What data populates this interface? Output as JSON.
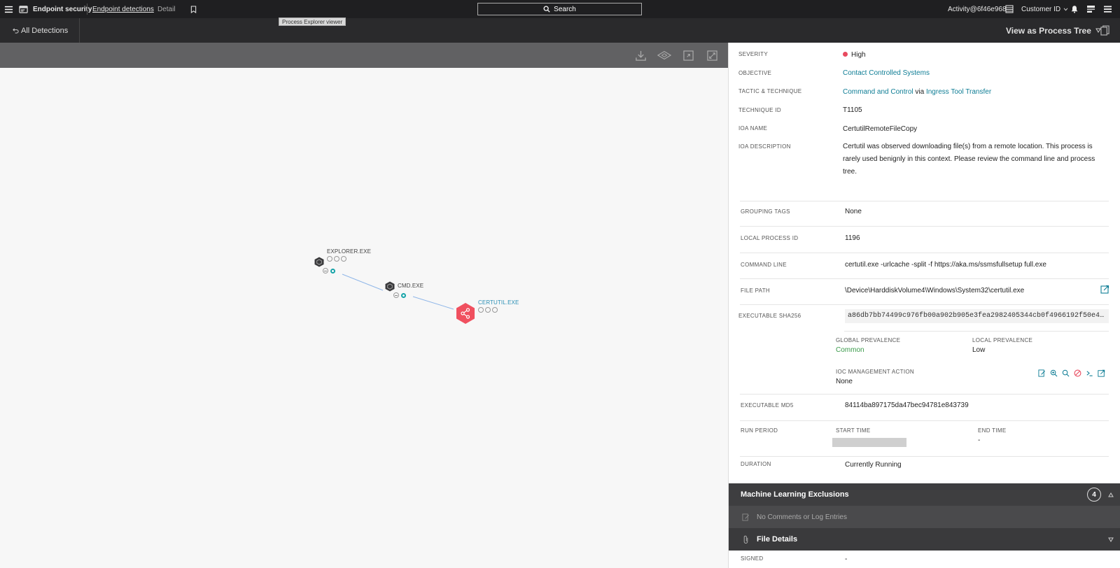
{
  "topbar": {
    "app_name": "Endpoint security",
    "breadcrumb_link": "Endpoint detections",
    "breadcrumb_current": "Detail",
    "search_label": "Search",
    "activity": "Activity@6f46e968",
    "customer_id": "Customer ID"
  },
  "subbar": {
    "back_label": "All Detections",
    "tooltip": "Process Explorer viewer",
    "view_label": "View as Process Tree"
  },
  "graph": {
    "nodes": [
      {
        "label": "EXPLORER.EXE"
      },
      {
        "label": "CMD.EXE"
      },
      {
        "label": "CERTUTIL.EXE"
      }
    ],
    "colors": {
      "highlight": "#f0505f",
      "edge": "#8fb6e8",
      "teal": "#16a3a8"
    }
  },
  "details": {
    "severity_label": "SEVERITY",
    "severity_value": "High",
    "objective_label": "OBJECTIVE",
    "objective_value": "Contact Controlled Systems",
    "tactic_label": "TACTIC & TECHNIQUE",
    "tactic_value": "Command and Control",
    "tactic_via": "via",
    "technique_value": "Ingress Tool Transfer",
    "technique_id_label": "TECHNIQUE ID",
    "technique_id_value": "T1105",
    "ioa_name_label": "IOA NAME",
    "ioa_name_value": "CertutilRemoteFileCopy",
    "ioa_desc_label": "IOA DESCRIPTION",
    "ioa_desc_value": "Certutil was observed downloading file(s) from a remote location. This process is rarely used benignly in this context. Please review the command line and process tree.",
    "grouping_tags_label": "GROUPING TAGS",
    "grouping_tags_value": "None",
    "local_pid_label": "LOCAL PROCESS ID",
    "local_pid_value": "1196",
    "command_line_label": "COMMAND LINE",
    "command_line_value": "certutil.exe -urlcache -split -f https://aka.ms/ssmsfullsetup full.exe",
    "file_path_label": "FILE PATH",
    "file_path_value": "\\Device\\HarddiskVolume4\\Windows\\System32\\certutil.exe",
    "sha256_label": "EXECUTABLE SHA256",
    "sha256_value": "a86db7bb74499c976fb00a902b905e3fea2982405344cb0f4966192f50e4db…",
    "global_prev_label": "GLOBAL PREVALENCE",
    "global_prev_value": "Common",
    "local_prev_label": "LOCAL PREVALENCE",
    "local_prev_value": "Low",
    "ioc_label": "IOC MANAGEMENT ACTION",
    "ioc_value": "None",
    "md5_label": "EXECUTABLE MD5",
    "md5_value": "84114ba897175da47bec94781e843739",
    "run_period_label": "RUN PERIOD",
    "start_time_label": "START TIME",
    "end_time_label": "END TIME",
    "end_time_value": "-",
    "duration_label": "DURATION",
    "duration_value": "Currently Running"
  },
  "sections": {
    "ml_exclusions": "Machine Learning Exclusions",
    "ml_count": "4",
    "no_comments": "No Comments or Log Entries",
    "file_details": "File Details",
    "signed_label": "SIGNED",
    "signed_value": "-"
  }
}
